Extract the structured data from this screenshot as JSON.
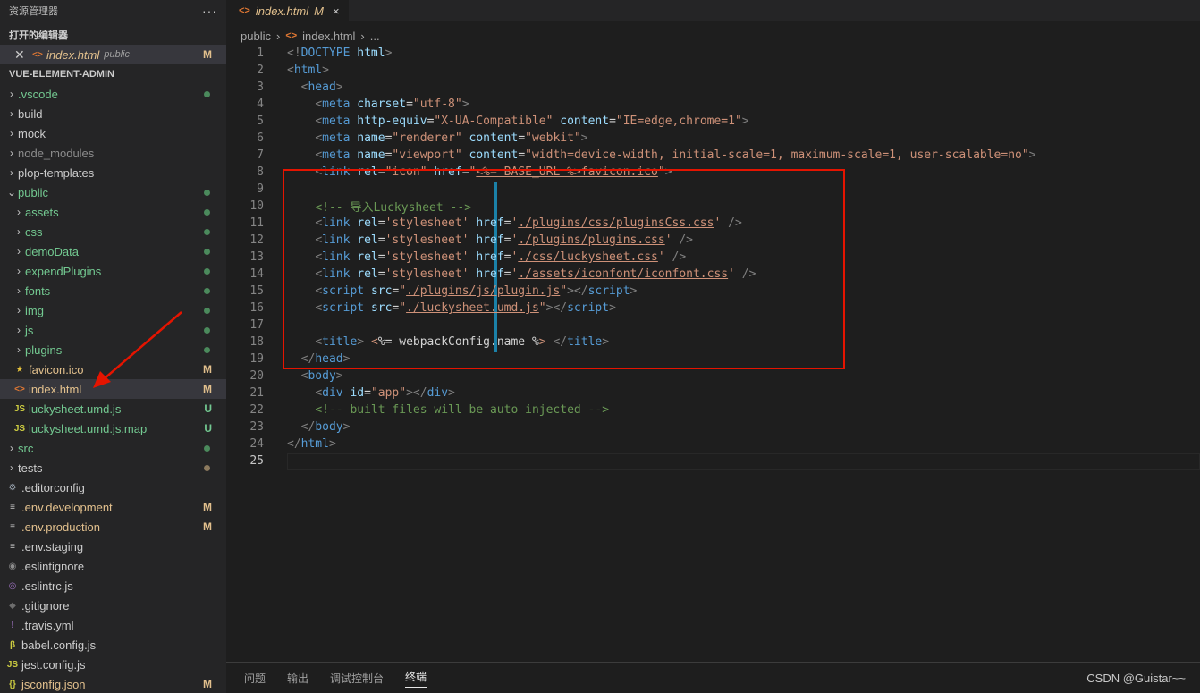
{
  "sidebar": {
    "title": "资源管理器",
    "more": "···",
    "open_editors_label": "打开的编辑器",
    "open_editor": {
      "name": "index.html",
      "folder": "public",
      "badge": "M"
    },
    "project_label": "VUE-ELEMENT-ADMIN",
    "tree": [
      {
        "label": ".vscode",
        "type": "folder",
        "color": "#73c991",
        "status": "dot-green"
      },
      {
        "label": "build",
        "type": "folder",
        "color": "#cccccc"
      },
      {
        "label": "mock",
        "type": "folder",
        "color": "#cccccc"
      },
      {
        "label": "node_modules",
        "type": "folder",
        "color": "#8c8c8c"
      },
      {
        "label": "plop-templates",
        "type": "folder",
        "color": "#cccccc"
      },
      {
        "label": "public",
        "type": "folder-open",
        "color": "#73c991",
        "status": "dot-green"
      },
      {
        "label": "assets",
        "type": "folder",
        "color": "#73c991",
        "status": "dot-green",
        "indent": 1
      },
      {
        "label": "css",
        "type": "folder",
        "color": "#73c991",
        "status": "dot-green",
        "indent": 1
      },
      {
        "label": "demoData",
        "type": "folder",
        "color": "#73c991",
        "status": "dot-green",
        "indent": 1
      },
      {
        "label": "expendPlugins",
        "type": "folder",
        "color": "#73c991",
        "status": "dot-green",
        "indent": 1
      },
      {
        "label": "fonts",
        "type": "folder",
        "color": "#73c991",
        "status": "dot-green",
        "indent": 1
      },
      {
        "label": "img",
        "type": "folder",
        "color": "#73c991",
        "status": "dot-green",
        "indent": 1
      },
      {
        "label": "js",
        "type": "folder",
        "color": "#73c991",
        "status": "dot-green",
        "indent": 1
      },
      {
        "label": "plugins",
        "type": "folder",
        "color": "#73c991",
        "status": "dot-green",
        "indent": 1
      },
      {
        "label": "favicon.ico",
        "type": "file",
        "icon": "star-icon",
        "color": "#e2c08d",
        "badge": "M",
        "indent": 1
      },
      {
        "label": "index.html",
        "type": "file",
        "icon": "html-icon",
        "color": "#e2c08d",
        "badge": "M",
        "indent": 1,
        "selected": true
      },
      {
        "label": "luckysheet.umd.js",
        "type": "file",
        "icon": "js-icon",
        "color": "#73c991",
        "badge": "U",
        "indent": 1
      },
      {
        "label": "luckysheet.umd.js.map",
        "type": "file",
        "icon": "js-icon",
        "color": "#73c991",
        "badge": "U",
        "indent": 1
      },
      {
        "label": "src",
        "type": "folder",
        "color": "#73c991",
        "status": "dot-green"
      },
      {
        "label": "tests",
        "type": "folder",
        "color": "#cccccc",
        "status": "dot-brown"
      },
      {
        "label": ".editorconfig",
        "type": "file",
        "icon": "gear-icon",
        "color": "#cccccc"
      },
      {
        "label": ".env.development",
        "type": "file",
        "icon": "lines-icon",
        "color": "#e2c08d",
        "badge": "M"
      },
      {
        "label": ".env.production",
        "type": "file",
        "icon": "lines-icon",
        "color": "#e2c08d",
        "badge": "M"
      },
      {
        "label": ".env.staging",
        "type": "file",
        "icon": "lines-icon",
        "color": "#cccccc"
      },
      {
        "label": ".eslintignore",
        "type": "file",
        "icon": "circle-icon",
        "color": "#cccccc"
      },
      {
        "label": ".eslintrc.js",
        "type": "file",
        "icon": "eslint-icon",
        "color": "#cccccc"
      },
      {
        "label": ".gitignore",
        "type": "file",
        "icon": "git-icon",
        "color": "#cccccc"
      },
      {
        "label": ".travis.yml",
        "type": "file",
        "icon": "exclamation-icon",
        "color": "#cccccc"
      },
      {
        "label": "babel.config.js",
        "type": "file",
        "icon": "babel-icon",
        "color": "#cccccc"
      },
      {
        "label": "jest.config.js",
        "type": "file",
        "icon": "js-icon",
        "color": "#cccccc"
      },
      {
        "label": "jsconfig.json",
        "type": "file",
        "icon": "json-icon",
        "color": "#e2c08d",
        "badge": "M"
      }
    ]
  },
  "tab": {
    "name": "index.html",
    "badge": "M",
    "close": "×"
  },
  "breadcrumb": {
    "folder": "public",
    "file": "index.html",
    "more": "..."
  },
  "editor": {
    "active_line": 25,
    "lines": [
      [
        [
          "t",
          "<!"
        ],
        [
          "g",
          "DOCTYPE"
        ],
        [
          "w",
          " "
        ],
        [
          "a",
          "html"
        ],
        [
          "t",
          ">"
        ]
      ],
      [
        [
          "t",
          "<"
        ],
        [
          "g",
          "html"
        ],
        [
          "t",
          ">"
        ]
      ],
      [
        [
          "w",
          "  "
        ],
        [
          "t",
          "<"
        ],
        [
          "g",
          "head"
        ],
        [
          "t",
          ">"
        ]
      ],
      [
        [
          "w",
          "    "
        ],
        [
          "t",
          "<"
        ],
        [
          "g",
          "meta"
        ],
        [
          "w",
          " "
        ],
        [
          "a",
          "charset"
        ],
        [
          "w",
          "="
        ],
        [
          "s",
          "\"utf-8\""
        ],
        [
          "t",
          ">"
        ]
      ],
      [
        [
          "w",
          "    "
        ],
        [
          "t",
          "<"
        ],
        [
          "g",
          "meta"
        ],
        [
          "w",
          " "
        ],
        [
          "a",
          "http-equiv"
        ],
        [
          "w",
          "="
        ],
        [
          "s",
          "\"X-UA-Compatible\""
        ],
        [
          "w",
          " "
        ],
        [
          "a",
          "content"
        ],
        [
          "w",
          "="
        ],
        [
          "s",
          "\"IE=edge,chrome=1\""
        ],
        [
          "t",
          ">"
        ]
      ],
      [
        [
          "w",
          "    "
        ],
        [
          "t",
          "<"
        ],
        [
          "g",
          "meta"
        ],
        [
          "w",
          " "
        ],
        [
          "a",
          "name"
        ],
        [
          "w",
          "="
        ],
        [
          "s",
          "\"renderer\""
        ],
        [
          "w",
          " "
        ],
        [
          "a",
          "content"
        ],
        [
          "w",
          "="
        ],
        [
          "s",
          "\"webkit\""
        ],
        [
          "t",
          ">"
        ]
      ],
      [
        [
          "w",
          "    "
        ],
        [
          "t",
          "<"
        ],
        [
          "g",
          "meta"
        ],
        [
          "w",
          " "
        ],
        [
          "a",
          "name"
        ],
        [
          "w",
          "="
        ],
        [
          "s",
          "\"viewport\""
        ],
        [
          "w",
          " "
        ],
        [
          "a",
          "content"
        ],
        [
          "w",
          "="
        ],
        [
          "s",
          "\"width=device-width, initial-scale=1, maximum-scale=1, user-scalable=no\""
        ],
        [
          "t",
          ">"
        ]
      ],
      [
        [
          "w",
          "    "
        ],
        [
          "t",
          "<"
        ],
        [
          "g",
          "link"
        ],
        [
          "w",
          " "
        ],
        [
          "a",
          "rel"
        ],
        [
          "w",
          "="
        ],
        [
          "s",
          "\"icon\""
        ],
        [
          "w",
          " "
        ],
        [
          "a",
          "href"
        ],
        [
          "w",
          "="
        ],
        [
          "s",
          "\""
        ],
        [
          "su",
          "<%= BASE_URL %>favicon.ico"
        ],
        [
          "s",
          "\""
        ],
        [
          "t",
          ">"
        ]
      ],
      [],
      [
        [
          "w",
          "    "
        ],
        [
          "c",
          "<!-- 导入Luckysheet -->"
        ]
      ],
      [
        [
          "w",
          "    "
        ],
        [
          "t",
          "<"
        ],
        [
          "g",
          "link"
        ],
        [
          "w",
          " "
        ],
        [
          "a",
          "rel"
        ],
        [
          "w",
          "="
        ],
        [
          "s",
          "'stylesheet'"
        ],
        [
          "w",
          " "
        ],
        [
          "a",
          "href"
        ],
        [
          "w",
          "="
        ],
        [
          "s",
          "'"
        ],
        [
          "su",
          "./plugins/css/pluginsCss.css"
        ],
        [
          "s",
          "'"
        ],
        [
          "w",
          " "
        ],
        [
          "t",
          "/>"
        ]
      ],
      [
        [
          "w",
          "    "
        ],
        [
          "t",
          "<"
        ],
        [
          "g",
          "link"
        ],
        [
          "w",
          " "
        ],
        [
          "a",
          "rel"
        ],
        [
          "w",
          "="
        ],
        [
          "s",
          "'stylesheet'"
        ],
        [
          "w",
          " "
        ],
        [
          "a",
          "href"
        ],
        [
          "w",
          "="
        ],
        [
          "s",
          "'"
        ],
        [
          "su",
          "./plugins/plugins.css"
        ],
        [
          "s",
          "'"
        ],
        [
          "w",
          " "
        ],
        [
          "t",
          "/>"
        ]
      ],
      [
        [
          "w",
          "    "
        ],
        [
          "t",
          "<"
        ],
        [
          "g",
          "link"
        ],
        [
          "w",
          " "
        ],
        [
          "a",
          "rel"
        ],
        [
          "w",
          "="
        ],
        [
          "s",
          "'stylesheet'"
        ],
        [
          "w",
          " "
        ],
        [
          "a",
          "href"
        ],
        [
          "w",
          "="
        ],
        [
          "s",
          "'"
        ],
        [
          "su",
          "./css/luckysheet.css"
        ],
        [
          "s",
          "'"
        ],
        [
          "w",
          " "
        ],
        [
          "t",
          "/>"
        ]
      ],
      [
        [
          "w",
          "    "
        ],
        [
          "t",
          "<"
        ],
        [
          "g",
          "link"
        ],
        [
          "w",
          " "
        ],
        [
          "a",
          "rel"
        ],
        [
          "w",
          "="
        ],
        [
          "s",
          "'stylesheet'"
        ],
        [
          "w",
          " "
        ],
        [
          "a",
          "href"
        ],
        [
          "w",
          "="
        ],
        [
          "s",
          "'"
        ],
        [
          "su",
          "./assets/iconfont/iconfont.css"
        ],
        [
          "s",
          "'"
        ],
        [
          "w",
          " "
        ],
        [
          "t",
          "/>"
        ]
      ],
      [
        [
          "w",
          "    "
        ],
        [
          "t",
          "<"
        ],
        [
          "g",
          "script"
        ],
        [
          "w",
          " "
        ],
        [
          "a",
          "src"
        ],
        [
          "w",
          "="
        ],
        [
          "s",
          "\""
        ],
        [
          "su",
          "./plugins/js/plugin.js"
        ],
        [
          "s",
          "\""
        ],
        [
          "t",
          "></"
        ],
        [
          "g",
          "script"
        ],
        [
          "t",
          ">"
        ]
      ],
      [
        [
          "w",
          "    "
        ],
        [
          "t",
          "<"
        ],
        [
          "g",
          "script"
        ],
        [
          "w",
          " "
        ],
        [
          "a",
          "src"
        ],
        [
          "w",
          "="
        ],
        [
          "s",
          "\""
        ],
        [
          "su",
          "./luckysheet.umd.js"
        ],
        [
          "s",
          "\""
        ],
        [
          "t",
          "></"
        ],
        [
          "g",
          "script"
        ],
        [
          "t",
          ">"
        ]
      ],
      [],
      [
        [
          "w",
          "    "
        ],
        [
          "t",
          "<"
        ],
        [
          "g",
          "title"
        ],
        [
          "t",
          ">"
        ],
        [
          "w",
          " "
        ],
        [
          "s",
          "<"
        ],
        [
          "w",
          "%= webpackConfig.name %"
        ],
        [
          "s",
          ">"
        ],
        [
          "w",
          " "
        ],
        [
          "t",
          "</"
        ],
        [
          "g",
          "title"
        ],
        [
          "t",
          ">"
        ]
      ],
      [
        [
          "w",
          "  "
        ],
        [
          "t",
          "</"
        ],
        [
          "g",
          "head"
        ],
        [
          "t",
          ">"
        ]
      ],
      [
        [
          "w",
          "  "
        ],
        [
          "t",
          "<"
        ],
        [
          "g",
          "body"
        ],
        [
          "t",
          ">"
        ]
      ],
      [
        [
          "w",
          "    "
        ],
        [
          "t",
          "<"
        ],
        [
          "g",
          "div"
        ],
        [
          "w",
          " "
        ],
        [
          "a",
          "id"
        ],
        [
          "w",
          "="
        ],
        [
          "s",
          "\"app\""
        ],
        [
          "t",
          "></"
        ],
        [
          "g",
          "div"
        ],
        [
          "t",
          ">"
        ]
      ],
      [
        [
          "w",
          "    "
        ],
        [
          "c",
          "<!-- built files will be auto injected -->"
        ]
      ],
      [
        [
          "w",
          "  "
        ],
        [
          "t",
          "</"
        ],
        [
          "g",
          "body"
        ],
        [
          "t",
          ">"
        ]
      ],
      [
        [
          "t",
          "</"
        ],
        [
          "g",
          "html"
        ],
        [
          "t",
          ">"
        ]
      ],
      []
    ]
  },
  "panel": {
    "tabs": [
      "问题",
      "输出",
      "调试控制台",
      "终端"
    ],
    "active": 3
  },
  "watermark": "CSDN @Guistar~~"
}
